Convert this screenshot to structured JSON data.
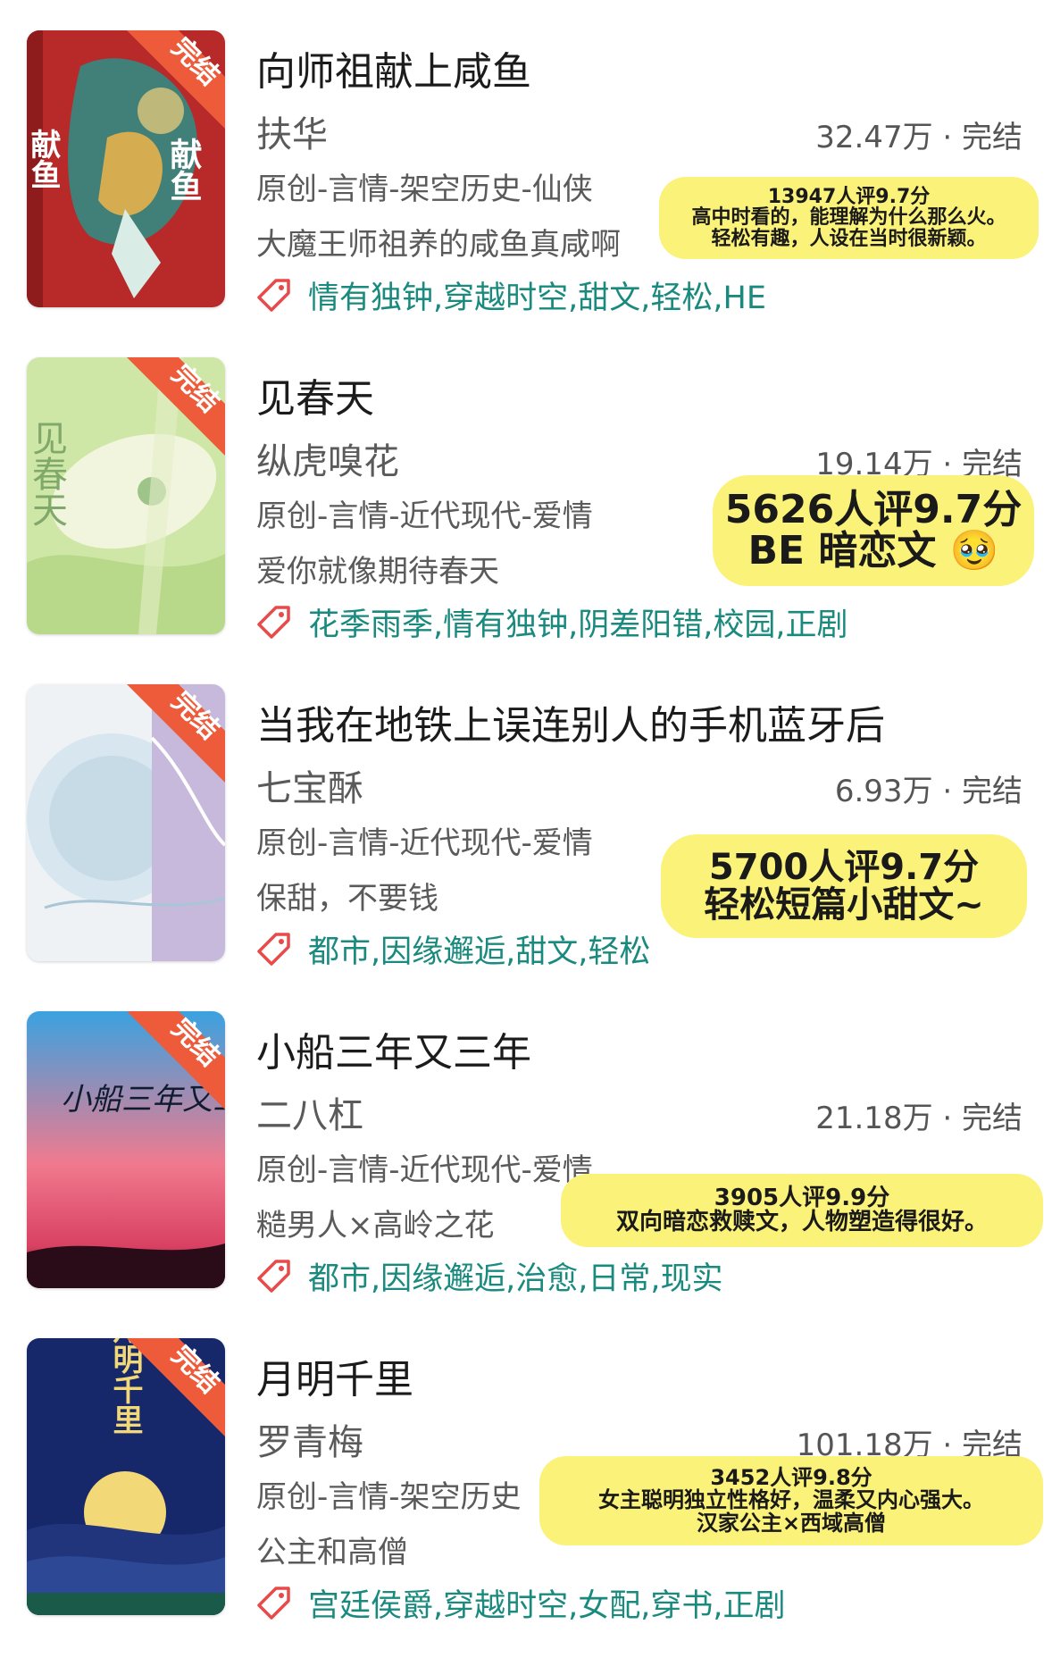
{
  "books": [
    {
      "title": "向师祖献上咸鱼",
      "author": "扶华",
      "stats": "32.47万 · 完结",
      "category": "原创-言情-架空历史-仙侠",
      "intro": "大魔王师祖养的咸鱼真咸啊",
      "tags": "情有独钟,穿越时空,甜文,轻松,HE",
      "badge": "完结",
      "cover_text": "献鱼",
      "note": [
        "13947人评9.7分",
        "高中时看的，能理解为什么那么火。",
        "轻松有趣，人设在当时很新颖。"
      ],
      "colors": {
        "cover_bg": "#b8292a",
        "cover_accent": "#2a8f86"
      }
    },
    {
      "title": "见春天",
      "author": "纵虎嗅花",
      "stats": "19.14万 · 完结",
      "category": "原创-言情-近代现代-爱情",
      "intro": "爱你就像期待春天",
      "tags": "花季雨季,情有独钟,阴差阳错,校园,正剧",
      "badge": "完结",
      "cover_text": "见春天",
      "note": [
        "5626人评9.7分",
        "BE 暗恋文 🥹"
      ],
      "colors": {
        "cover_bg": "#cfe7a6",
        "cover_accent": "#f2f5de"
      }
    },
    {
      "title": "当我在地铁上误连别人的手机蓝牙后",
      "author": "七宝酥",
      "stats": "6.93万 · 完结",
      "category": "原创-言情-近代现代-爱情",
      "intro": "保甜，不要钱",
      "tags": "都市,因缘邂逅,甜文,轻松",
      "badge": "完结",
      "cover_text": "",
      "note": [
        "5700人评9.7分",
        "轻松短篇小甜文~"
      ],
      "colors": {
        "cover_bg": "#eef2f4",
        "cover_accent": "#c7b9dc"
      }
    },
    {
      "title": "小船三年又三年",
      "author": "二八杠",
      "stats": "21.18万 · 完结",
      "category": "原创-言情-近代现代-爱情",
      "intro": "糙男人×高岭之花",
      "tags": "都市,因缘邂逅,治愈,日常,现实",
      "badge": "完结",
      "cover_text": "小船三年又三年",
      "note": [
        "3905人评9.9分",
        "双向暗恋救赎文，人物塑造得很好。"
      ],
      "colors": {
        "cover_bg": "#4aa8de",
        "cover_accent": "#f07a8e"
      }
    },
    {
      "title": "月明千里",
      "author": "罗青梅",
      "stats": "101.18万 · 完结",
      "category": "原创-言情-架空历史",
      "intro": "公主和高僧",
      "tags": "宫廷侯爵,穿越时空,女配,穿书,正剧",
      "badge": "完结",
      "cover_text": "月明千里",
      "note": [
        "3452人评9.8分",
        "女主聪明独立性格好，温柔又内心强大。",
        "汉家公主×西域高僧"
      ],
      "colors": {
        "cover_bg": "#16286a",
        "cover_accent": "#f3d878"
      }
    }
  ],
  "colors": {
    "tag_text": "#1a8a7e",
    "tag_icon": "#e84a4a",
    "badge_bg": "#ee5b3a",
    "note_bg": "#fbf27a"
  },
  "icons": {
    "tag": "tag-icon"
  }
}
